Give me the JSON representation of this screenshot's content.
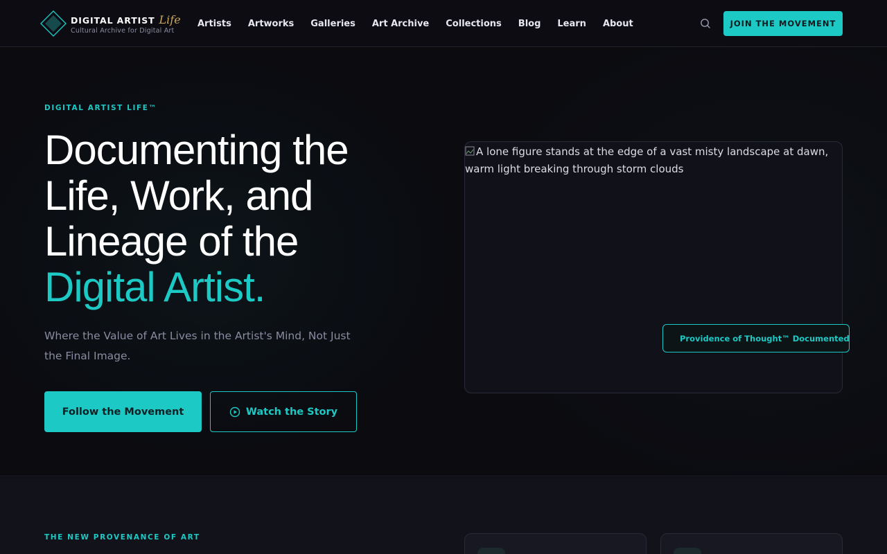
{
  "brand": {
    "title": "DIGITAL ARTIST",
    "script": "Life",
    "subtitle": "Cultural Archive for Digital Art"
  },
  "nav": {
    "items": [
      {
        "label": "Artists"
      },
      {
        "label": "Artworks"
      },
      {
        "label": "Galleries"
      },
      {
        "label": "Art Archive"
      },
      {
        "label": "Collections"
      },
      {
        "label": "Blog"
      },
      {
        "label": "Learn"
      },
      {
        "label": "About"
      }
    ],
    "search_icon": "search-icon",
    "cta_label": "JOIN THE MOVEMENT"
  },
  "hero": {
    "eyebrow": "DIGITAL ARTIST LIFE™",
    "title_lines": [
      "Documenting the",
      "Life, Work, and",
      "Lineage of the"
    ],
    "title_accent": "Digital Artist.",
    "subtitle": "Where the Value of Art Lives in the Artist's Mind, Not Just the Final Image.",
    "primary_button": "Follow the Movement",
    "secondary_button": "Watch the Story",
    "image_alt": "A lone figure stands at the edge of a vast misty landscape at dawn, warm light breaking through storm clouds",
    "badge": "Providence of Thought™ Documented"
  },
  "section2": {
    "eyebrow": "THE NEW PROVENANCE OF ART"
  },
  "colors": {
    "accent": "#1cc9c4",
    "background": "#0b0b10",
    "gold": "#c9a75b",
    "muted_text": "#8b8ba1"
  }
}
